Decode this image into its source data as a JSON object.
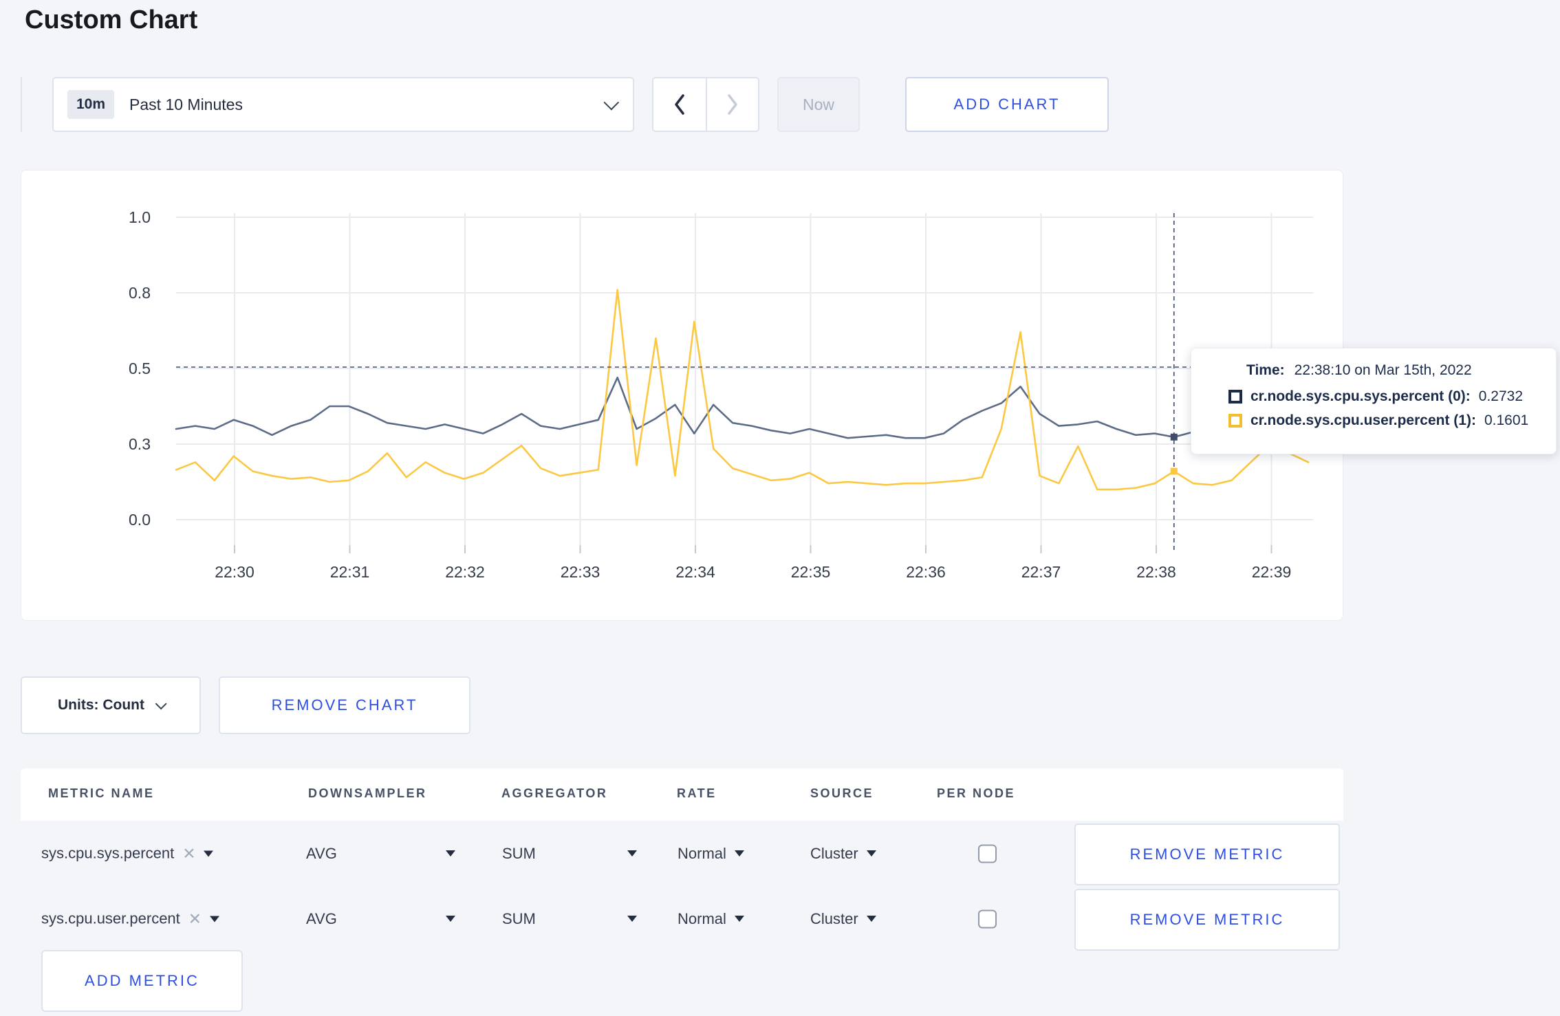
{
  "page": {
    "title": "Custom Chart"
  },
  "toolbar": {
    "time_window_badge": "10m",
    "time_window_label": "Past 10 Minutes",
    "now_label": "Now",
    "add_chart_label": "ADD CHART"
  },
  "chart": {
    "tooltip": {
      "time_label": "Time:",
      "time_value": "22:38:10 on Mar 15th, 2022",
      "rows": [
        {
          "label": "cr.node.sys.cpu.sys.percent (0):",
          "value": "0.2732",
          "swatch_color": "#1c2b4a"
        },
        {
          "label": "cr.node.sys.cpu.user.percent (1):",
          "value": "0.1601",
          "swatch_color": "#f3be2b"
        }
      ]
    }
  },
  "chart_data": {
    "type": "line",
    "title": "",
    "xlabel": "",
    "ylabel": "",
    "y_range": [
      0,
      1
    ],
    "grid": true,
    "x_start_time": "22:29:30",
    "x_interval_seconds": 10,
    "x_tick_labels": [
      "22:30",
      "22:31",
      "22:32",
      "22:33",
      "22:34",
      "22:35",
      "22:36",
      "22:37",
      "22:38",
      "22:39"
    ],
    "y_tick_labels": [
      "1.0",
      "0.8",
      "0.5",
      "0.3",
      "0.0"
    ],
    "crosshair": {
      "index": 52,
      "time": "22:38:10"
    },
    "series": [
      {
        "name": "cr.node.sys.cpu.sys.percent",
        "color": "#5c6c88",
        "values": [
          0.3,
          0.31,
          0.3,
          0.33,
          0.31,
          0.28,
          0.31,
          0.33,
          0.375,
          0.375,
          0.35,
          0.32,
          0.31,
          0.3,
          0.315,
          0.3,
          0.285,
          0.315,
          0.35,
          0.31,
          0.3,
          0.315,
          0.33,
          0.47,
          0.3,
          0.335,
          0.38,
          0.285,
          0.38,
          0.32,
          0.31,
          0.295,
          0.285,
          0.3,
          0.285,
          0.27,
          0.275,
          0.28,
          0.27,
          0.27,
          0.285,
          0.33,
          0.36,
          0.385,
          0.44,
          0.35,
          0.31,
          0.315,
          0.325,
          0.3,
          0.28,
          0.285,
          0.2732,
          0.29,
          0.31,
          0.325,
          0.3,
          0.295,
          0.305,
          0.31
        ]
      },
      {
        "name": "cr.node.sys.cpu.user.percent",
        "color": "#fcc842",
        "values": [
          0.165,
          0.19,
          0.13,
          0.21,
          0.16,
          0.145,
          0.135,
          0.14,
          0.125,
          0.13,
          0.16,
          0.22,
          0.14,
          0.19,
          0.155,
          0.135,
          0.155,
          0.2,
          0.245,
          0.17,
          0.145,
          0.155,
          0.165,
          0.76,
          0.18,
          0.6,
          0.145,
          0.655,
          0.235,
          0.17,
          0.15,
          0.13,
          0.135,
          0.155,
          0.12,
          0.125,
          0.12,
          0.115,
          0.12,
          0.12,
          0.125,
          0.13,
          0.14,
          0.3,
          0.62,
          0.145,
          0.12,
          0.243,
          0.1,
          0.1,
          0.105,
          0.12,
          0.1601,
          0.12,
          0.115,
          0.13,
          0.19,
          0.25,
          0.22,
          0.19
        ]
      }
    ]
  },
  "units_row": {
    "units_label": "Units: Count",
    "remove_chart_label": "REMOVE CHART"
  },
  "metrics_table": {
    "headers": [
      "METRIC NAME",
      "DOWNSAMPLER",
      "AGGREGATOR",
      "RATE",
      "SOURCE",
      "PER NODE"
    ],
    "rows": [
      {
        "metric": "sys.cpu.sys.percent",
        "downsampler": "AVG",
        "aggregator": "SUM",
        "rate": "Normal",
        "source": "Cluster",
        "per_node_checked": false,
        "remove_label": "REMOVE METRIC"
      },
      {
        "metric": "sys.cpu.user.percent",
        "downsampler": "AVG",
        "aggregator": "SUM",
        "rate": "Normal",
        "source": "Cluster",
        "per_node_checked": false,
        "remove_label": "REMOVE METRIC"
      }
    ],
    "add_metric_label": "ADD METRIC"
  }
}
